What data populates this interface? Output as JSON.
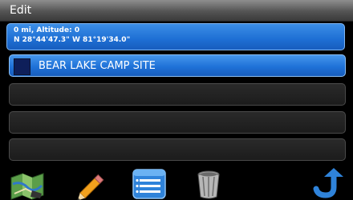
{
  "window": {
    "title": "Edit"
  },
  "location": {
    "line1": "0 mi, Altitude: 0",
    "line2": "N 28°44'47.3\"  W 81°19'34.0\""
  },
  "list": {
    "items": [
      {
        "label": "BEAR LAKE CAMP SITE",
        "selected": true,
        "swatch_color": "#0e1f5a"
      },
      {
        "label": ""
      },
      {
        "label": ""
      },
      {
        "label": ""
      }
    ]
  },
  "toolbar": {
    "buttons": [
      {
        "icon": "map-icon"
      },
      {
        "icon": "pencil-icon"
      },
      {
        "icon": "notes-icon"
      },
      {
        "icon": "trash-icon"
      },
      {
        "icon": "back-arrow-icon"
      }
    ]
  },
  "colors": {
    "accent": "#1e6fd4",
    "row_background": "#222222",
    "title_bar": "#545454"
  }
}
